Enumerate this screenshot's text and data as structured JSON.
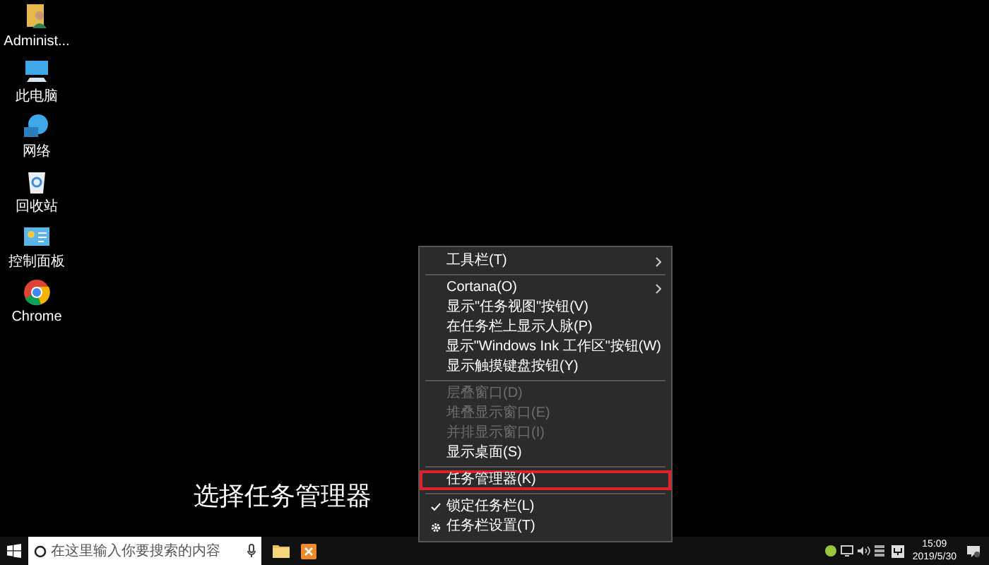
{
  "desktop_icons": [
    {
      "label": "Administ...",
      "kind": "user"
    },
    {
      "label": "此电脑",
      "kind": "computer"
    },
    {
      "label": "网络",
      "kind": "network"
    },
    {
      "label": "回收站",
      "kind": "recycle"
    },
    {
      "label": "控制面板",
      "kind": "panel"
    },
    {
      "label": "Chrome",
      "kind": "chrome"
    }
  ],
  "caption": "选择任务管理器",
  "context_menu": [
    {
      "kind": "item",
      "label": "工具栏(T)",
      "submenu": true,
      "disabled": false,
      "checked": false,
      "highlighted": false
    },
    {
      "kind": "separator"
    },
    {
      "kind": "item",
      "label": "Cortana(O)",
      "submenu": true,
      "disabled": false,
      "checked": false,
      "highlighted": false
    },
    {
      "kind": "item",
      "label": "显示\"任务视图\"按钮(V)",
      "submenu": false,
      "disabled": false,
      "checked": false,
      "highlighted": false
    },
    {
      "kind": "item",
      "label": "在任务栏上显示人脉(P)",
      "submenu": false,
      "disabled": false,
      "checked": false,
      "highlighted": false
    },
    {
      "kind": "item",
      "label": "显示\"Windows Ink 工作区\"按钮(W)",
      "submenu": false,
      "disabled": false,
      "checked": false,
      "highlighted": false
    },
    {
      "kind": "item",
      "label": "显示触摸键盘按钮(Y)",
      "submenu": false,
      "disabled": false,
      "checked": false,
      "highlighted": false
    },
    {
      "kind": "separator"
    },
    {
      "kind": "item",
      "label": "层叠窗口(D)",
      "submenu": false,
      "disabled": true,
      "checked": false,
      "highlighted": false
    },
    {
      "kind": "item",
      "label": "堆叠显示窗口(E)",
      "submenu": false,
      "disabled": true,
      "checked": false,
      "highlighted": false
    },
    {
      "kind": "item",
      "label": "并排显示窗口(I)",
      "submenu": false,
      "disabled": true,
      "checked": false,
      "highlighted": false
    },
    {
      "kind": "item",
      "label": "显示桌面(S)",
      "submenu": false,
      "disabled": false,
      "checked": false,
      "highlighted": false
    },
    {
      "kind": "separator"
    },
    {
      "kind": "item",
      "label": "任务管理器(K)",
      "submenu": false,
      "disabled": false,
      "checked": false,
      "highlighted": true
    },
    {
      "kind": "separator"
    },
    {
      "kind": "item",
      "label": "锁定任务栏(L)",
      "submenu": false,
      "disabled": false,
      "checked": true,
      "highlighted": false
    },
    {
      "kind": "settings",
      "label": "任务栏设置(T)",
      "submenu": false,
      "disabled": false,
      "checked": false,
      "highlighted": false
    }
  ],
  "taskbar": {
    "search": {
      "placeholder": "在这里输入你要搜索的内容"
    },
    "time": "15:09",
    "date": "2019/5/30"
  }
}
